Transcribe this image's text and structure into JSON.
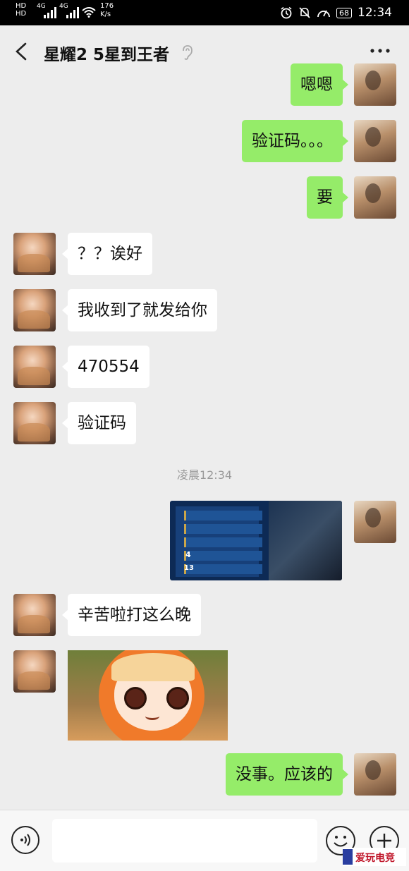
{
  "status_bar": {
    "hd_badges": [
      "HD",
      "HD"
    ],
    "network_labels": [
      "4G",
      "4G"
    ],
    "speed_value": "176",
    "speed_unit": "K/s",
    "battery": "68",
    "time": "12:34"
  },
  "header": {
    "title": "星耀2 5星到王者"
  },
  "messages": [
    {
      "side": "me",
      "text": "嗯嗯"
    },
    {
      "side": "me",
      "text": "验证码。。。"
    },
    {
      "side": "me",
      "text": "要"
    },
    {
      "side": "her",
      "text": "？？诶好"
    },
    {
      "side": "her",
      "text": "我收到了就发给你"
    },
    {
      "side": "her",
      "text": "470554"
    },
    {
      "side": "her",
      "text": "验证码"
    },
    {
      "side": "her",
      "text": "辛苦啦打这么晚"
    },
    {
      "side": "me",
      "text": "没事。应该的"
    }
  ],
  "timestamp": "凌晨12:34",
  "game_screenshot": {
    "row_numbers": [
      "4",
      "13"
    ]
  },
  "watermark": {
    "text": "爱玩电竞"
  },
  "colors": {
    "my_bubble": "#95ec69",
    "her_bubble": "#ffffff",
    "background": "#ededed"
  }
}
